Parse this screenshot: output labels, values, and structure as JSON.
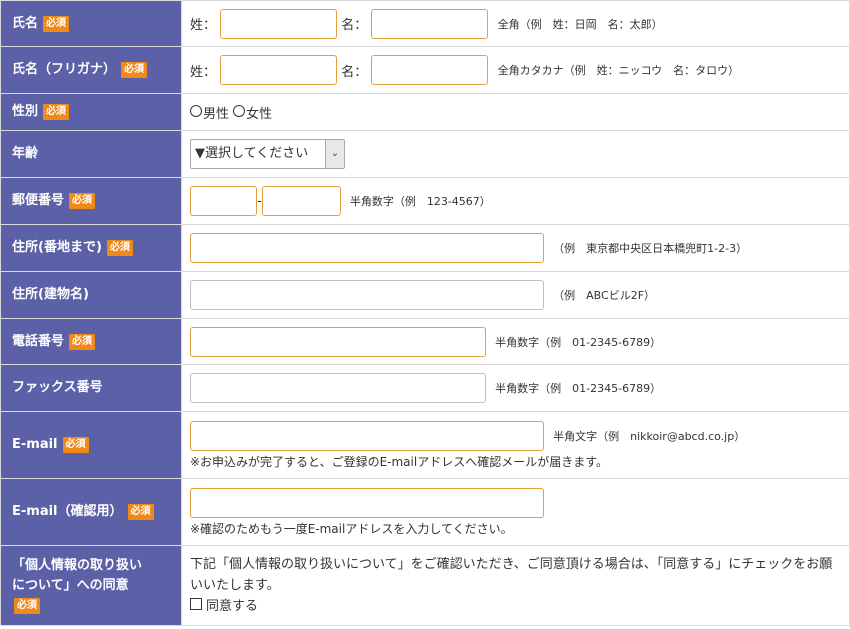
{
  "badge": "必須",
  "rows": {
    "name": {
      "label": "氏名",
      "sei": "姓：",
      "mei": "名：",
      "hint": "全角（例　姓：日岡　名：太郎）"
    },
    "kana": {
      "label": "氏名（フリガナ）",
      "sei": "姓：",
      "mei": "名：",
      "hint": "全角カタカナ（例　姓：ニッコウ　名：タロウ）"
    },
    "gender": {
      "label": "性別",
      "male": "男性",
      "female": "女性"
    },
    "age": {
      "label": "年齢",
      "select_value": "▼選択してください",
      "arrow": "⌄"
    },
    "zip": {
      "label": "郵便番号",
      "separator": "-",
      "hint": "半角数字（例　123-4567）"
    },
    "address1": {
      "label": "住所(番地まで)",
      "hint": "（例　東京都中央区日本橋兜町1-2-3）"
    },
    "address2": {
      "label": "住所(建物名)",
      "hint": "（例　ABCビル2F）"
    },
    "phone": {
      "label": "電話番号",
      "hint": "半角数字（例　01-2345-6789）"
    },
    "fax": {
      "label": "ファックス番号",
      "hint": "半角数字（例　01-2345-6789）"
    },
    "email": {
      "label": "E-mail",
      "hint": "半角文字（例　nikkoir@abcd.co.jp）",
      "note": "※お申込みが完了すると、ご登録のE-mailアドレスへ確認メールが届きます。"
    },
    "email_confirm": {
      "label": "E-mail（確認用）",
      "note": "※確認のためもう一度E-mailアドレスを入力してください。"
    },
    "privacy": {
      "label_line1": "「個人情報の取り扱い",
      "label_line2": "について」への同意",
      "text": "下記「個人情報の取り扱いについて」をご確認いただき、ご同意頂ける場合は、「同意する」にチェックをお願いいたします。",
      "checkbox_label": "同意する"
    }
  }
}
